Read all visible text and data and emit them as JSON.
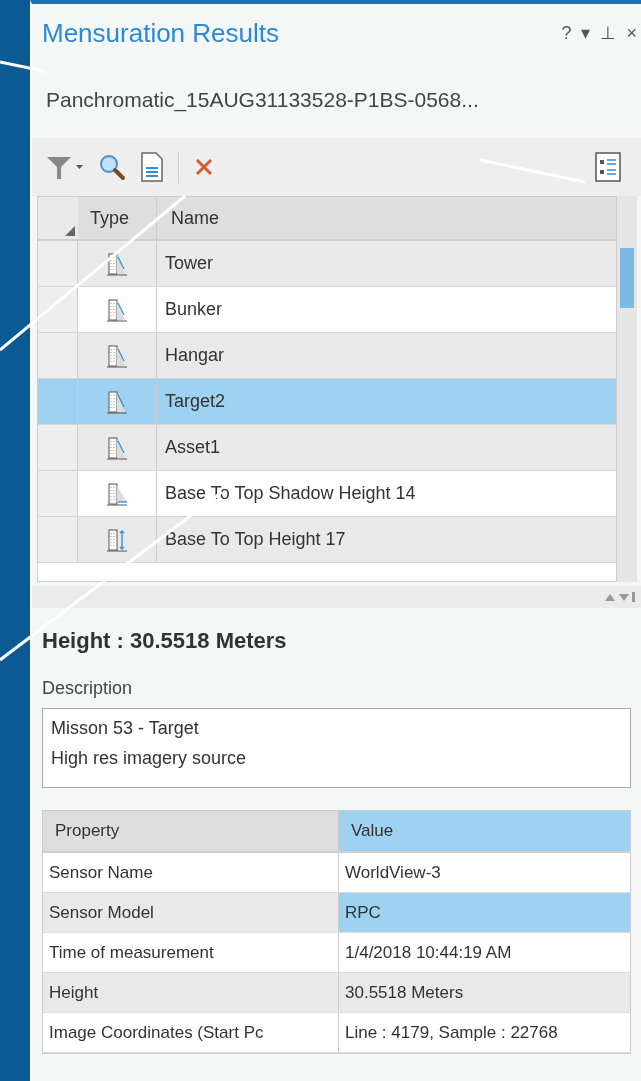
{
  "pane": {
    "title": "Mensuration Results",
    "header_buttons": [
      "?",
      "▾",
      "⊥",
      "×"
    ],
    "source": "Panchromatic_15AUG31133528-P1BS-0568..."
  },
  "grid": {
    "columns": [
      "Type",
      "Name"
    ],
    "rows": [
      {
        "name": "Tower",
        "kind": "height",
        "selected": false
      },
      {
        "name": "Bunker",
        "kind": "height",
        "selected": false
      },
      {
        "name": "Hangar",
        "kind": "height",
        "selected": false
      },
      {
        "name": "Target2",
        "kind": "height",
        "selected": true
      },
      {
        "name": "Asset1",
        "kind": "height",
        "selected": false
      },
      {
        "name": "Base To Top Shadow Height 14",
        "kind": "shadow",
        "selected": false
      },
      {
        "name": "Base To Top Height 17",
        "kind": "base_top",
        "selected": false
      }
    ]
  },
  "details": {
    "heading": "Height : 30.5518 Meters",
    "description_label": "Description",
    "description": [
      "Misson 53 - Target",
      "High res imagery source"
    ],
    "columns": [
      "Property",
      "Value"
    ],
    "rows": [
      {
        "property": "Sensor Name",
        "value": "WorldView-3",
        "selected": false
      },
      {
        "property": "Sensor Model",
        "value": "RPC",
        "selected": true
      },
      {
        "property": "Time of measurement",
        "value": "1/4/2018 10:44:19 AM",
        "selected": false
      },
      {
        "property": "Height",
        "value": "30.5518 Meters",
        "selected": false
      },
      {
        "property": "Image Coordinates (Start Pc",
        "value": "Line : 4179, Sample : 22768",
        "selected": false
      }
    ]
  }
}
